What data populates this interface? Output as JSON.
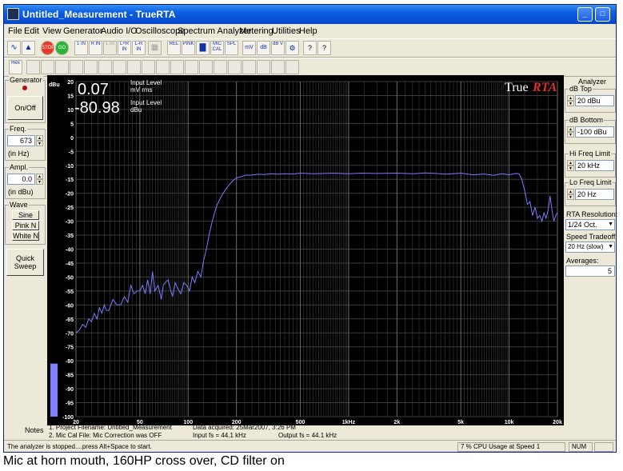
{
  "window": {
    "title": "Untitled_Measurement - TrueRTA",
    "minimize": "_",
    "maximize": "□",
    "close": "✕"
  },
  "menu": [
    "File",
    "Edit",
    "View",
    "Generator",
    "Audio I/O",
    "Oscilloscope",
    "Spectrum Analyzer",
    "Metering",
    "Utilities",
    "Help"
  ],
  "toolbar1": [
    "∿",
    "▲",
    "STOP",
    "GO",
    "1 IN",
    "R IN",
    "1 IN",
    "L+R IN",
    "L-R IN",
    "▦",
    "REL",
    "PINK",
    "▇",
    "MIC CAL",
    "SPL",
    "mV",
    "dB",
    "dB V",
    "⚙",
    "?",
    "?"
  ],
  "toolbar2": [
    "Hex",
    "",
    "",
    "",
    "",
    "",
    "",
    "",
    "",
    "",
    "",
    "",
    "",
    "",
    "",
    "",
    "",
    "",
    "",
    "",
    ""
  ],
  "generator": {
    "section": "Generator",
    "onoff": "On/Off",
    "freq_label": "Freq.",
    "freq_value": "673",
    "freq_unit": "(in Hz)",
    "ampl_label": "Ampl.",
    "ampl_value": "0.0",
    "ampl_unit": "(in dBu)",
    "wave_label": "Wave",
    "waves": [
      "Sine",
      "Pink N",
      "White N"
    ],
    "quick_sweep": "Quick Sweep"
  },
  "analyzer": {
    "section": "Analyzer",
    "db_top_label": "dB Top",
    "db_top_value": "20 dBu",
    "db_bottom_label": "dB Bottom",
    "db_bottom_value": "-100 dBu",
    "hi_freq_label": "Hi Freq Limit",
    "hi_freq_value": "20 kHz",
    "lo_freq_label": "Lo Freq Limit",
    "lo_freq_value": "20 Hz",
    "rta_res_label": "RTA Resolution:",
    "rta_res_value": "1/24 Oct.",
    "speed_label": "Speed Tradeoff:",
    "speed_value": "20 Hz (slow)",
    "averages_label": "Averages:",
    "averages_value": "5"
  },
  "readout": {
    "value1": "0.07",
    "label1a": "Input Level",
    "label1b": "mV rms",
    "value2": "-80.98",
    "label2a": "Input Level",
    "label2b": "dBu",
    "logo_true": "True",
    "logo_rta": "RTA"
  },
  "notes": {
    "label": "Notes",
    "line1": "1. Project Filename: Untitled_Measurement",
    "line2": "2. Mic Cal File: Mic Correction was OFF",
    "acquired": "Data acquired: 25Mar2007, 3:26 PM",
    "input_fs": "Input fs = 44.1 kHz",
    "output_fs": "Output fs = 44.1 kHz"
  },
  "status": {
    "message": "The analyzer is stopped....press Alt+Space to start.",
    "cpu": "7 % CPU Usage at Speed 1",
    "num": "NUM"
  },
  "caption": "Mic at horn mouth, 160HP cross over, CD filter on",
  "colors": {
    "trace": "#7b7bff",
    "bar": "#8080ff",
    "grid": "#3c3c3c",
    "logo_rta": "#e0302a"
  },
  "chart_data": {
    "type": "line",
    "title": "",
    "ylabel": "dBu",
    "xlabel": "",
    "xscale": "log",
    "xlim": [
      20,
      20000
    ],
    "ylim": [
      -100,
      20
    ],
    "yticks": [
      20,
      15,
      10,
      5,
      0,
      -5,
      -10,
      -15,
      -20,
      -25,
      -30,
      -35,
      -40,
      -45,
      -50,
      -55,
      -60,
      -65,
      -70,
      -75,
      -80,
      -85,
      -90,
      -95,
      -100
    ],
    "xticks": [
      "20",
      "50",
      "100",
      "200",
      "500",
      "1kHz",
      "2k",
      "5k",
      "10k",
      "20k"
    ],
    "xtick_values": [
      20,
      50,
      100,
      200,
      500,
      1000,
      2000,
      5000,
      10000,
      20000
    ],
    "level_meter_dbu": -81,
    "x": [
      20,
      21,
      22,
      23,
      24,
      25,
      26,
      27,
      28,
      29,
      30,
      31,
      32,
      34,
      36,
      38,
      40,
      42,
      44,
      46,
      48,
      50,
      52,
      54,
      56,
      58,
      60,
      62,
      65,
      68,
      70,
      72,
      75,
      78,
      80,
      83,
      86,
      90,
      94,
      98,
      102,
      106,
      110,
      115,
      120,
      125,
      130,
      135,
      140,
      146,
      152,
      158,
      165,
      172,
      180,
      190,
      200,
      215,
      230,
      250,
      270,
      300,
      330,
      360,
      400,
      450,
      500,
      600,
      700,
      800,
      1000,
      1200,
      1500,
      2000,
      2500,
      3000,
      3500,
      4000,
      5000,
      6000,
      7000,
      8000,
      9000,
      10000,
      11000,
      11500,
      12000,
      12500,
      13000,
      13500,
      14000,
      14500,
      15000,
      15500,
      16000,
      16500,
      17000,
      17500,
      18000,
      18500,
      19000,
      19500,
      20000
    ],
    "y": [
      -70,
      -69,
      -67,
      -68,
      -65,
      -66,
      -63,
      -65,
      -61,
      -63,
      -60,
      -62,
      -62,
      -58,
      -60,
      -60,
      -57,
      -59,
      -53,
      -56,
      -55,
      -55,
      -53,
      -56,
      -51,
      -56,
      -48,
      -55,
      -53,
      -58,
      -53,
      -52,
      -51,
      -55,
      -57,
      -52,
      -54,
      -56,
      -52,
      -53,
      -55,
      -50,
      -52,
      -48,
      -50,
      -44,
      -40,
      -35,
      -31,
      -27,
      -24,
      -22,
      -20,
      -18.5,
      -17,
      -15.5,
      -14.5,
      -14,
      -13.5,
      -13.5,
      -13.2,
      -13.3,
      -13,
      -13.2,
      -13,
      -13.1,
      -12.8,
      -13,
      -12.9,
      -12.8,
      -13,
      -12.8,
      -12.9,
      -12.8,
      -13,
      -12.7,
      -12.9,
      -13.2,
      -12.8,
      -13.4,
      -13.1,
      -13.6,
      -13,
      -13.4,
      -12.9,
      -13,
      -15,
      -19,
      -24,
      -23,
      -28,
      -25,
      -29,
      -28,
      -30,
      -27,
      -29,
      -26,
      -21,
      -26,
      -30,
      -28,
      -27
    ]
  }
}
